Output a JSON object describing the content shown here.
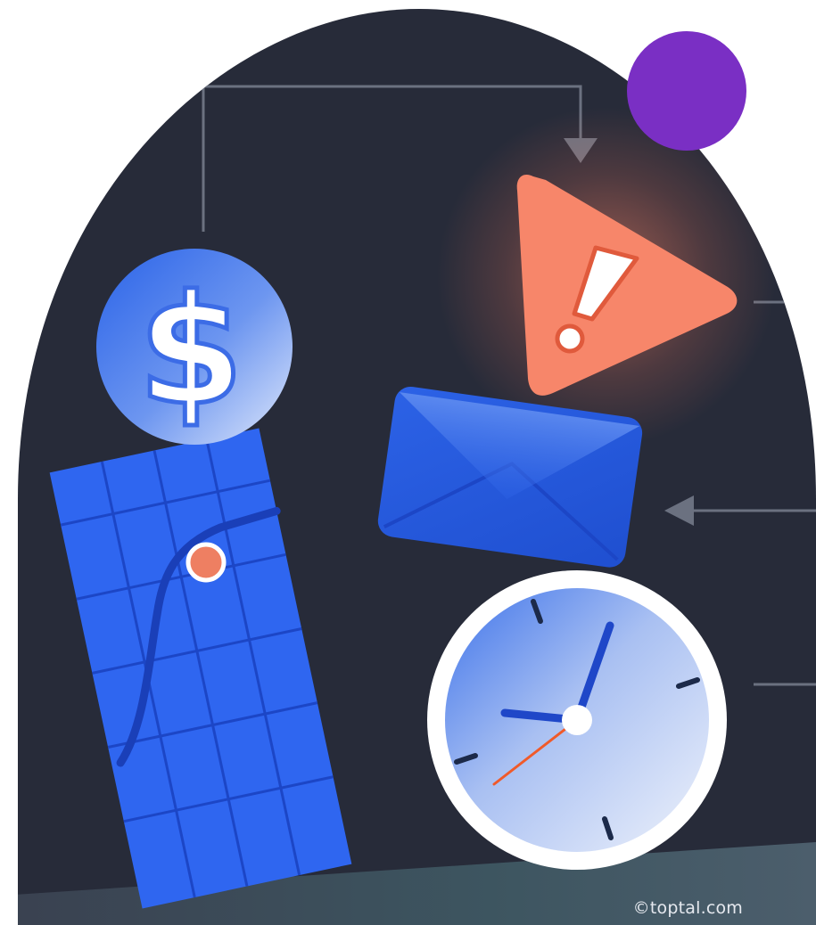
{
  "illustration": {
    "credit": "©toptal.com",
    "colors": {
      "background": "#272b39",
      "connector": "#6b7180",
      "purple_dot": "#7a2fc4",
      "warning": "#f7866a",
      "blue": "#2e6df2",
      "calendar": "#2f66f0",
      "calendar_point": "#ee7f62",
      "clock_face": "#dbe5f8",
      "clock_hour_hand": "#1f47c8",
      "clock_second_hand": "#f05a2a"
    },
    "icons": [
      "dollar-coin-icon",
      "warning-icon",
      "envelope-icon",
      "clock-icon",
      "calendar-chart-icon"
    ]
  }
}
